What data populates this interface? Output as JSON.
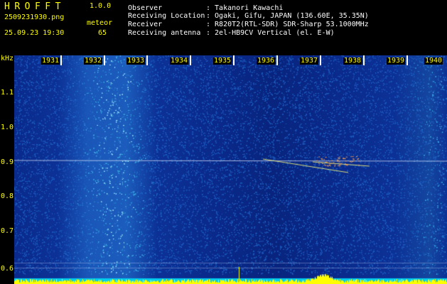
{
  "app": {
    "logo": "HROFFT",
    "version": "1.0.0",
    "filename": "2509231930.png",
    "timestamp": "25.09.23 19:30",
    "mode_label": "meteor",
    "meteor_count": "65"
  },
  "info": [
    {
      "label": "Observer",
      "value": ": Takanori Kawachi"
    },
    {
      "label": "Receiving Location",
      "value": ": Ogaki, Gifu, JAPAN (136.60E, 35.35N)"
    },
    {
      "label": "Receiver",
      "value": ": R820T2(RTL-SDR) SDR-Sharp 53.1000MHz"
    },
    {
      "label": "Receiving antenna",
      "value": ": 2el-HB9CV Vertical (el. E-W)"
    }
  ],
  "axes": {
    "y_unit": "kHz",
    "y_ticks": [
      "1.1",
      "1.0",
      "0.9",
      "0.8",
      "0.7",
      "0.6"
    ],
    "x_ticks": [
      "1931",
      "1932",
      "1933",
      "1934",
      "1935",
      "1936",
      "1937",
      "1938",
      "1939",
      "1940"
    ]
  },
  "colors": {
    "background": "#000000",
    "header_text": "#ffff00",
    "info_text": "#ffffff",
    "waterfall_base": "#0a2a8c",
    "signal_line": "#ffff00"
  }
}
